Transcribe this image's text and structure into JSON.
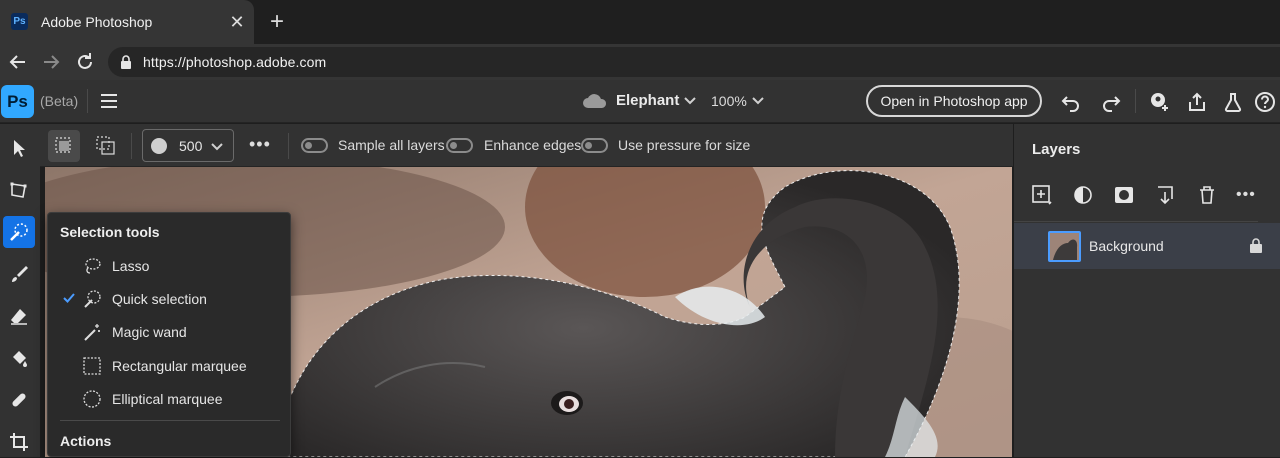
{
  "browser": {
    "tab_title": "Adobe Photoshop",
    "tab_favicon": "Ps",
    "close_glyph": "✕",
    "new_tab_glyph": "+",
    "url": "https://photoshop.adobe.com"
  },
  "appbar": {
    "logo": "Ps",
    "beta_label": "(Beta)",
    "document_name": "Elephant",
    "zoom_level": "100%",
    "open_app_label": "Open in Photoshop app"
  },
  "options": {
    "brush_size": "500",
    "sample_all_layers": "Sample all layers",
    "enhance_edges": "Enhance edges",
    "use_pressure": "Use pressure for size"
  },
  "layers_panel": {
    "title": "Layers",
    "layers": [
      {
        "name": "Background",
        "locked": true
      }
    ]
  },
  "flyout": {
    "heading": "Selection tools",
    "items": [
      {
        "label": "Lasso",
        "selected": false
      },
      {
        "label": "Quick selection",
        "selected": true
      },
      {
        "label": "Magic wand",
        "selected": false
      },
      {
        "label": "Rectangular marquee",
        "selected": false
      },
      {
        "label": "Elliptical marquee",
        "selected": false
      }
    ],
    "actions_heading": "Actions"
  },
  "colors": {
    "accent": "#1473e6",
    "ps_logo": "#31a8ff"
  }
}
